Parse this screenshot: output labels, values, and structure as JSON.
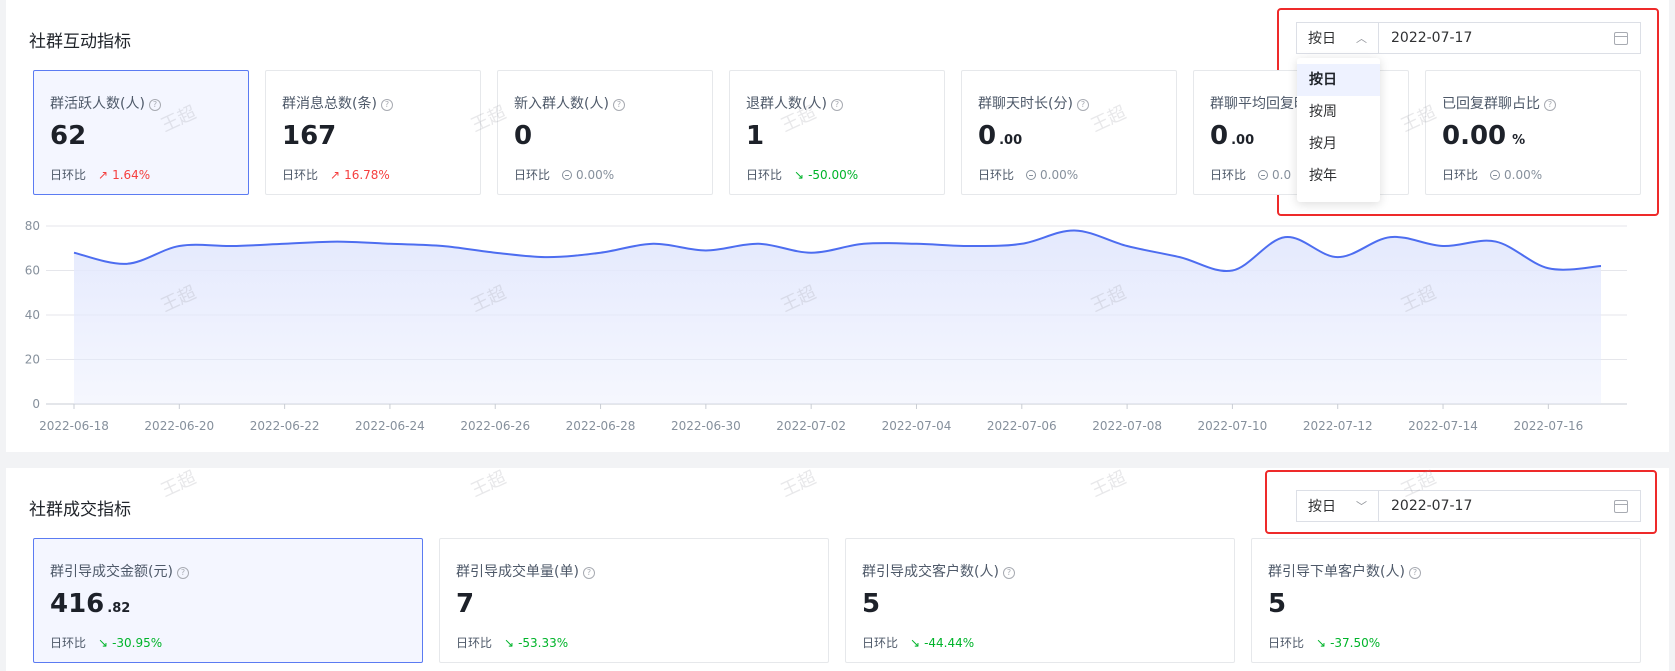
{
  "interaction": {
    "title": "社群互动指标",
    "period_selected": "按日",
    "date_value": "2022-07-17",
    "period_options": [
      "按日",
      "按周",
      "按月",
      "按年"
    ],
    "cards": [
      {
        "label": "群活跃人数(人)",
        "value": "62",
        "decimal": "",
        "unit": "",
        "ratio_label": "日环比",
        "ratio": "1.64%",
        "trend": "up"
      },
      {
        "label": "群消息总数(条)",
        "value": "167",
        "decimal": "",
        "unit": "",
        "ratio_label": "日环比",
        "ratio": "16.78%",
        "trend": "up"
      },
      {
        "label": "新入群人数(人)",
        "value": "0",
        "decimal": "",
        "unit": "",
        "ratio_label": "日环比",
        "ratio": "0.00%",
        "trend": "flat"
      },
      {
        "label": "退群人数(人)",
        "value": "1",
        "decimal": "",
        "unit": "",
        "ratio_label": "日环比",
        "ratio": "-50.00%",
        "trend": "down"
      },
      {
        "label": "群聊天时长(分)",
        "value": "0",
        "decimal": ".00",
        "unit": "",
        "ratio_label": "日环比",
        "ratio": "0.00%",
        "trend": "flat"
      },
      {
        "label": "群聊平均回复时",
        "value": "0",
        "decimal": ".00",
        "unit": "",
        "ratio_label": "日环比",
        "ratio": "0.0",
        "trend": "flat"
      },
      {
        "label": "已回复群聊占比",
        "value": "0.00",
        "decimal": "",
        "unit": "%",
        "ratio_label": "日环比",
        "ratio": "0.00%",
        "trend": "flat"
      }
    ]
  },
  "chart_data": {
    "type": "area",
    "color": "#4d6df0",
    "fill_color": "#e4e9fd",
    "ylim": [
      0,
      80
    ],
    "y_ticks": [
      "0",
      "20",
      "40",
      "60",
      "80"
    ],
    "x_tick_labels": [
      "2022-06-18",
      "2022-06-20",
      "2022-06-22",
      "2022-06-24",
      "2022-06-26",
      "2022-06-28",
      "2022-06-30",
      "2022-07-02",
      "2022-07-04",
      "2022-07-06",
      "2022-07-08",
      "2022-07-10",
      "2022-07-12",
      "2022-07-14",
      "2022-07-16"
    ],
    "x": [
      "2022-06-18",
      "2022-06-19",
      "2022-06-20",
      "2022-06-21",
      "2022-06-22",
      "2022-06-23",
      "2022-06-24",
      "2022-06-25",
      "2022-06-26",
      "2022-06-27",
      "2022-06-28",
      "2022-06-29",
      "2022-06-30",
      "2022-07-01",
      "2022-07-02",
      "2022-07-03",
      "2022-07-04",
      "2022-07-05",
      "2022-07-06",
      "2022-07-07",
      "2022-07-08",
      "2022-07-09",
      "2022-07-10",
      "2022-07-11",
      "2022-07-12",
      "2022-07-13",
      "2022-07-14",
      "2022-07-15",
      "2022-07-16",
      "2022-07-17"
    ],
    "values": [
      68,
      63,
      71,
      71,
      72,
      73,
      72,
      71,
      68,
      66,
      68,
      72,
      69,
      72,
      68,
      72,
      72,
      71,
      72,
      78,
      71,
      66,
      60,
      75,
      66,
      75,
      71,
      73,
      61,
      62
    ],
    "grid": true
  },
  "transaction": {
    "title": "社群成交指标",
    "period_selected": "按日",
    "date_value": "2022-07-17",
    "cards": [
      {
        "label": "群引导成交金额(元)",
        "value": "416",
        "decimal": ".82",
        "ratio_label": "日环比",
        "ratio": "-30.95%",
        "trend": "down"
      },
      {
        "label": "群引导成交单量(单)",
        "value": "7",
        "decimal": "",
        "ratio_label": "日环比",
        "ratio": "-53.33%",
        "trend": "down"
      },
      {
        "label": "群引导成交客户数(人)",
        "value": "5",
        "decimal": "",
        "ratio_label": "日环比",
        "ratio": "-44.44%",
        "trend": "down"
      },
      {
        "label": "群引导下单客户数(人)",
        "value": "5",
        "decimal": "",
        "ratio_label": "日环比",
        "ratio": "-37.50%",
        "trend": "down"
      }
    ]
  },
  "watermark_text": "王超"
}
